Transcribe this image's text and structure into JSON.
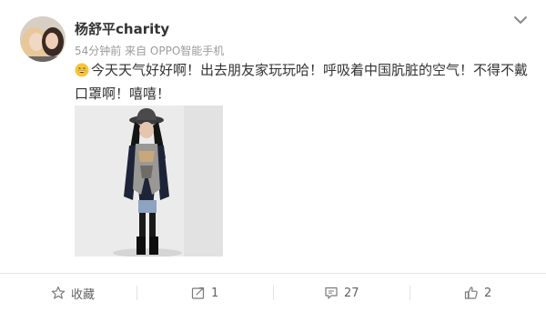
{
  "post": {
    "username": "杨舒平charity",
    "meta": "54分钟前 来自 OPPO智能手机",
    "text": "今天天气好好啊！出去朋友家玩玩哈！呼吸着中国肮脏的空气！不得不戴口罩啊！嘻嘻！",
    "emoji_icon": "grinning-face-icon",
    "menu_icon": "chevron-down-icon"
  },
  "actions": {
    "favorite": {
      "label": "收藏",
      "icon": "star-icon"
    },
    "repost": {
      "count": "1",
      "icon": "share-icon"
    },
    "comment": {
      "count": "27",
      "icon": "comment-icon"
    },
    "like": {
      "count": "2",
      "icon": "thumbs-up-icon"
    }
  },
  "colors": {
    "username": "#333333",
    "meta": "#9b9b9b",
    "action_text": "#636363",
    "divider": "#e6e6e6"
  }
}
